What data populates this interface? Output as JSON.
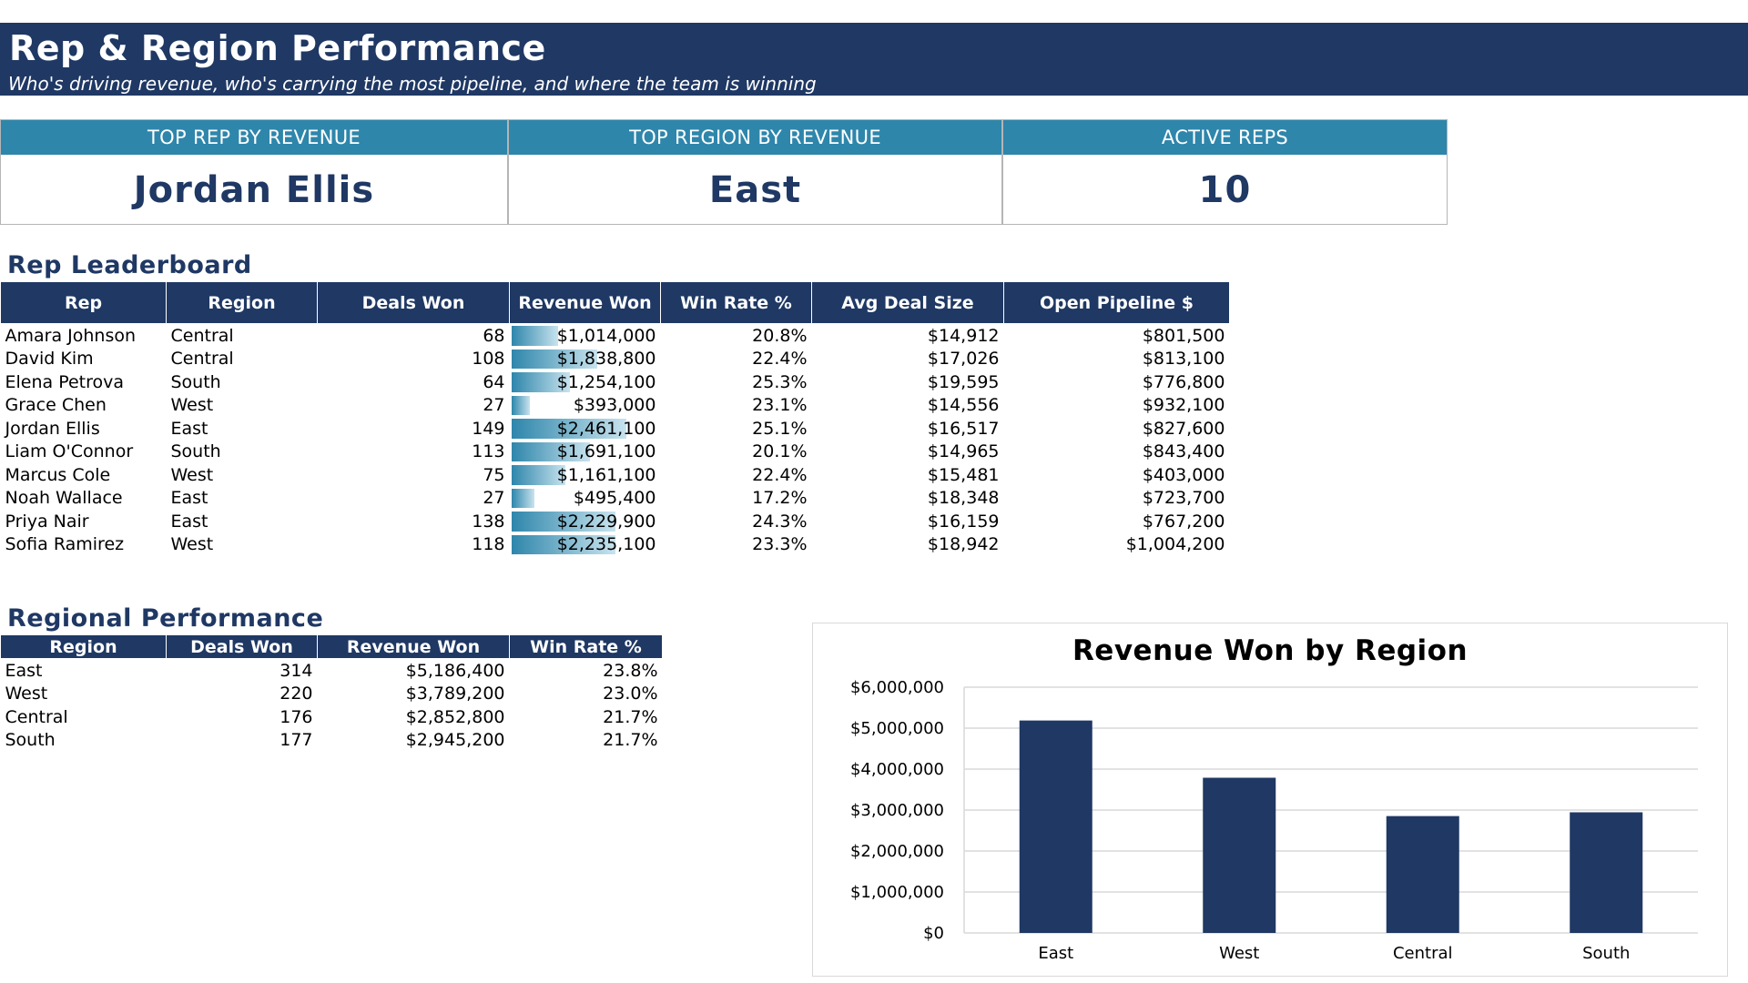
{
  "header": {
    "title": "Rep & Region Performance",
    "subtitle": "Who's driving revenue, who's carrying the most pipeline, and where the team is winning"
  },
  "kpis": [
    {
      "label": "TOP REP BY REVENUE",
      "value": "Jordan Ellis"
    },
    {
      "label": "TOP REGION BY REVENUE",
      "value": "East"
    },
    {
      "label": "ACTIVE REPS",
      "value": "10"
    }
  ],
  "leaderboard": {
    "title": "Rep Leaderboard",
    "columns": [
      "Rep",
      "Region",
      "Deals Won",
      "Revenue Won",
      "Win Rate %",
      "Avg Deal Size",
      "Open Pipeline $"
    ],
    "rows": [
      {
        "rep": "Amara Johnson",
        "region": "Central",
        "deals": "68",
        "revenue": "$1,014,000",
        "revenue_value": 1014000,
        "win_rate": "20.8%",
        "avg_deal": "$14,912",
        "pipeline": "$801,500"
      },
      {
        "rep": "David Kim",
        "region": "Central",
        "deals": "108",
        "revenue": "$1,838,800",
        "revenue_value": 1838800,
        "win_rate": "22.4%",
        "avg_deal": "$17,026",
        "pipeline": "$813,100"
      },
      {
        "rep": "Elena Petrova",
        "region": "South",
        "deals": "64",
        "revenue": "$1,254,100",
        "revenue_value": 1254100,
        "win_rate": "25.3%",
        "avg_deal": "$19,595",
        "pipeline": "$776,800"
      },
      {
        "rep": "Grace Chen",
        "region": "West",
        "deals": "27",
        "revenue": "$393,000",
        "revenue_value": 393000,
        "win_rate": "23.1%",
        "avg_deal": "$14,556",
        "pipeline": "$932,100"
      },
      {
        "rep": "Jordan Ellis",
        "region": "East",
        "deals": "149",
        "revenue": "$2,461,100",
        "revenue_value": 2461100,
        "win_rate": "25.1%",
        "avg_deal": "$16,517",
        "pipeline": "$827,600"
      },
      {
        "rep": "Liam O'Connor",
        "region": "South",
        "deals": "113",
        "revenue": "$1,691,100",
        "revenue_value": 1691100,
        "win_rate": "20.1%",
        "avg_deal": "$14,965",
        "pipeline": "$843,400"
      },
      {
        "rep": "Marcus Cole",
        "region": "West",
        "deals": "75",
        "revenue": "$1,161,100",
        "revenue_value": 1161100,
        "win_rate": "22.4%",
        "avg_deal": "$15,481",
        "pipeline": "$403,000"
      },
      {
        "rep": "Noah Wallace",
        "region": "East",
        "deals": "27",
        "revenue": "$495,400",
        "revenue_value": 495400,
        "win_rate": "17.2%",
        "avg_deal": "$18,348",
        "pipeline": "$723,700"
      },
      {
        "rep": "Priya Nair",
        "region": "East",
        "deals": "138",
        "revenue": "$2,229,900",
        "revenue_value": 2229900,
        "win_rate": "24.3%",
        "avg_deal": "$16,159",
        "pipeline": "$767,200"
      },
      {
        "rep": "Sofia Ramirez",
        "region": "West",
        "deals": "118",
        "revenue": "$2,235,100",
        "revenue_value": 2235100,
        "win_rate": "23.3%",
        "avg_deal": "$18,942",
        "pipeline": "$1,004,200"
      }
    ]
  },
  "regional": {
    "title": "Regional Performance",
    "columns": [
      "Region",
      "Deals Won",
      "Revenue Won",
      "Win Rate %"
    ],
    "rows": [
      {
        "region": "East",
        "deals": "314",
        "revenue": "$5,186,400",
        "win_rate": "23.8%"
      },
      {
        "region": "West",
        "deals": "220",
        "revenue": "$3,789,200",
        "win_rate": "23.0%"
      },
      {
        "region": "Central",
        "deals": "176",
        "revenue": "$2,852,800",
        "win_rate": "21.7%"
      },
      {
        "region": "South",
        "deals": "177",
        "revenue": "$2,945,200",
        "win_rate": "21.7%"
      }
    ]
  },
  "chart_data": {
    "type": "bar",
    "title": "Revenue Won by Region",
    "categories": [
      "East",
      "West",
      "Central",
      "South"
    ],
    "values": [
      5186400,
      3789200,
      2852800,
      2945200
    ],
    "ylim": [
      0,
      6000000
    ],
    "yticks": [
      0,
      1000000,
      2000000,
      3000000,
      4000000,
      5000000,
      6000000
    ],
    "ytick_labels": [
      "$0",
      "$1,000,000",
      "$2,000,000",
      "$3,000,000",
      "$4,000,000",
      "$5,000,000",
      "$6,000,000"
    ],
    "xlabel": "",
    "ylabel": "",
    "grid": true,
    "bar_color": "#1f3864",
    "gridline_color": "#d9d9d9"
  },
  "colors": {
    "navy": "#1f3864",
    "teal": "#2e86ab",
    "data_bar_light": "#c8e3ee"
  }
}
